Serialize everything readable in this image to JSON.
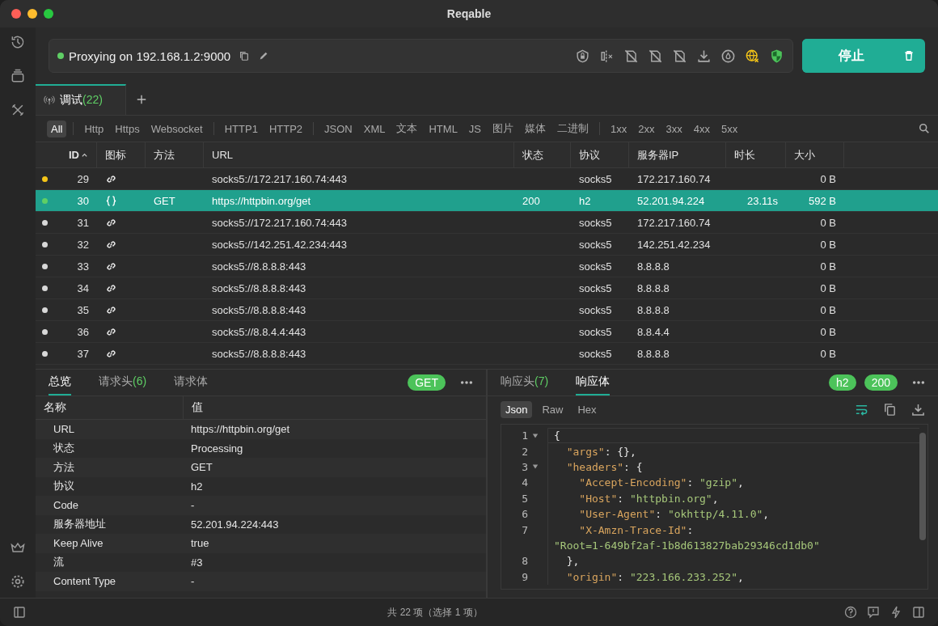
{
  "window": {
    "title": "Reqable"
  },
  "proxy": {
    "status_on": true,
    "label": "Proxying on 192.168.1.2:9000"
  },
  "stop_button": {
    "label": "停止"
  },
  "session_tabs": [
    {
      "label": "调试",
      "count": "(22)",
      "selected": true
    }
  ],
  "filters": [
    [
      {
        "label": "All",
        "selected": true
      }
    ],
    [
      {
        "label": "Http",
        "selected": false
      },
      {
        "label": "Https",
        "selected": false
      },
      {
        "label": "Websocket",
        "selected": false
      }
    ],
    [
      {
        "label": "HTTP1",
        "selected": false
      },
      {
        "label": "HTTP2",
        "selected": false
      }
    ],
    [
      {
        "label": "JSON",
        "selected": false
      },
      {
        "label": "XML",
        "selected": false
      },
      {
        "label": "文本",
        "selected": false
      },
      {
        "label": "HTML",
        "selected": false
      },
      {
        "label": "JS",
        "selected": false
      },
      {
        "label": "图片",
        "selected": false
      },
      {
        "label": "媒体",
        "selected": false
      },
      {
        "label": "二进制",
        "selected": false
      }
    ],
    [
      {
        "label": "1xx",
        "selected": false
      },
      {
        "label": "2xx",
        "selected": false
      },
      {
        "label": "3xx",
        "selected": false
      },
      {
        "label": "4xx",
        "selected": false
      },
      {
        "label": "5xx",
        "selected": false
      }
    ]
  ],
  "table": {
    "columns": [
      "ID",
      "图标",
      "方法",
      "URL",
      "状态",
      "协议",
      "服务器IP",
      "时长",
      "大小"
    ],
    "rows": [
      {
        "color": "#f5c518",
        "id": "29",
        "kind": "tunnel",
        "url": "socks5://172.217.160.74:443",
        "protocol": "socks5",
        "ip": "172.217.160.74",
        "size": "0 B",
        "selected": false
      },
      {
        "color": "#5fcf65",
        "id": "30",
        "kind": "json",
        "method": "GET",
        "url": "https://httpbin.org/get",
        "status": "200",
        "protocol": "h2",
        "ip": "52.201.94.224",
        "duration": "23.11s",
        "size": "592 B",
        "selected": true
      },
      {
        "color": "#d8d8d8",
        "id": "31",
        "kind": "tunnel",
        "url": "socks5://172.217.160.74:443",
        "protocol": "socks5",
        "ip": "172.217.160.74",
        "size": "0 B",
        "selected": false
      },
      {
        "color": "#d8d8d8",
        "id": "32",
        "kind": "tunnel",
        "url": "socks5://142.251.42.234:443",
        "protocol": "socks5",
        "ip": "142.251.42.234",
        "size": "0 B",
        "selected": false
      },
      {
        "color": "#d8d8d8",
        "id": "33",
        "kind": "tunnel",
        "url": "socks5://8.8.8.8:443",
        "protocol": "socks5",
        "ip": "8.8.8.8",
        "size": "0 B",
        "selected": false
      },
      {
        "color": "#d8d8d8",
        "id": "34",
        "kind": "tunnel",
        "url": "socks5://8.8.8.8:443",
        "protocol": "socks5",
        "ip": "8.8.8.8",
        "size": "0 B",
        "selected": false
      },
      {
        "color": "#d8d8d8",
        "id": "35",
        "kind": "tunnel",
        "url": "socks5://8.8.8.8:443",
        "protocol": "socks5",
        "ip": "8.8.8.8",
        "size": "0 B",
        "selected": false
      },
      {
        "color": "#d8d8d8",
        "id": "36",
        "kind": "tunnel",
        "url": "socks5://8.8.4.4:443",
        "protocol": "socks5",
        "ip": "8.8.4.4",
        "size": "0 B",
        "selected": false
      },
      {
        "color": "#d8d8d8",
        "id": "37",
        "kind": "tunnel",
        "url": "socks5://8.8.8.8:443",
        "protocol": "socks5",
        "ip": "8.8.8.8",
        "size": "0 B",
        "selected": false
      }
    ]
  },
  "request_panel": {
    "tabs": [
      {
        "label": "总览",
        "selected": true
      },
      {
        "label": "请求头",
        "count": "(6)",
        "selected": false
      },
      {
        "label": "请求体",
        "selected": false
      }
    ],
    "badge": "GET",
    "columns": [
      "名称",
      "值"
    ],
    "rows": [
      {
        "name": "URL",
        "value": "https://httpbin.org/get"
      },
      {
        "name": "状态",
        "value": "Processing"
      },
      {
        "name": "方法",
        "value": "GET"
      },
      {
        "name": "协议",
        "value": "h2"
      },
      {
        "name": "Code",
        "value": "-"
      },
      {
        "name": "服务器地址",
        "value": "52.201.94.224:443"
      },
      {
        "name": "Keep Alive",
        "value": "true"
      },
      {
        "name": "流",
        "value": "#3"
      },
      {
        "name": "Content Type",
        "value": "-"
      }
    ]
  },
  "response_panel": {
    "tabs": [
      {
        "label": "响应头",
        "count": "(7)",
        "selected": false
      },
      {
        "label": "响应体",
        "selected": true
      }
    ],
    "badges": [
      "h2",
      "200"
    ],
    "formats": [
      {
        "label": "Json",
        "selected": true
      },
      {
        "label": "Raw",
        "selected": false
      },
      {
        "label": "Hex",
        "selected": false
      }
    ],
    "code": [
      {
        "number": "1",
        "fold": true,
        "tokens": [
          {
            "kind": "punct",
            "text": "{"
          }
        ]
      },
      {
        "number": "2",
        "fold": false,
        "tokens": [
          {
            "kind": "key",
            "text": "  \"args\""
          },
          {
            "kind": "punct",
            "text": ": {},"
          }
        ]
      },
      {
        "number": "3",
        "fold": true,
        "tokens": [
          {
            "kind": "key",
            "text": "  \"headers\""
          },
          {
            "kind": "punct",
            "text": ": {"
          }
        ]
      },
      {
        "number": "4",
        "fold": false,
        "tokens": [
          {
            "kind": "key",
            "text": "    \"Accept-Encoding\""
          },
          {
            "kind": "punct",
            "text": ": "
          },
          {
            "kind": "string",
            "text": "\"gzip\""
          },
          {
            "kind": "punct",
            "text": ","
          }
        ]
      },
      {
        "number": "5",
        "fold": false,
        "tokens": [
          {
            "kind": "key",
            "text": "    \"Host\""
          },
          {
            "kind": "punct",
            "text": ": "
          },
          {
            "kind": "string",
            "text": "\"httpbin.org\""
          },
          {
            "kind": "punct",
            "text": ","
          }
        ]
      },
      {
        "number": "6",
        "fold": false,
        "tokens": [
          {
            "kind": "key",
            "text": "    \"User-Agent\""
          },
          {
            "kind": "punct",
            "text": ": "
          },
          {
            "kind": "string",
            "text": "\"okhttp/4.11.0\""
          },
          {
            "kind": "punct",
            "text": ","
          }
        ]
      },
      {
        "number": "7",
        "fold": false,
        "tokens": [
          {
            "kind": "key",
            "text": "    \"X-Amzn-Trace-Id\""
          },
          {
            "kind": "punct",
            "text": ":"
          }
        ]
      },
      {
        "fold": false,
        "tokens": [
          {
            "kind": "string",
            "text": "\"Root=1-649bf2af-1b8d613827bab29346cd1db0\""
          }
        ]
      },
      {
        "number": "8",
        "fold": false,
        "tokens": [
          {
            "kind": "punct",
            "text": "  },"
          }
        ]
      },
      {
        "number": "9",
        "fold": false,
        "tokens": [
          {
            "kind": "key",
            "text": "  \"origin\""
          },
          {
            "kind": "punct",
            "text": ": "
          },
          {
            "kind": "string",
            "text": "\"223.166.233.252\""
          },
          {
            "kind": "punct",
            "text": ","
          }
        ]
      }
    ]
  },
  "status_bar": {
    "text": "共 22 项（选择 1 项）"
  }
}
